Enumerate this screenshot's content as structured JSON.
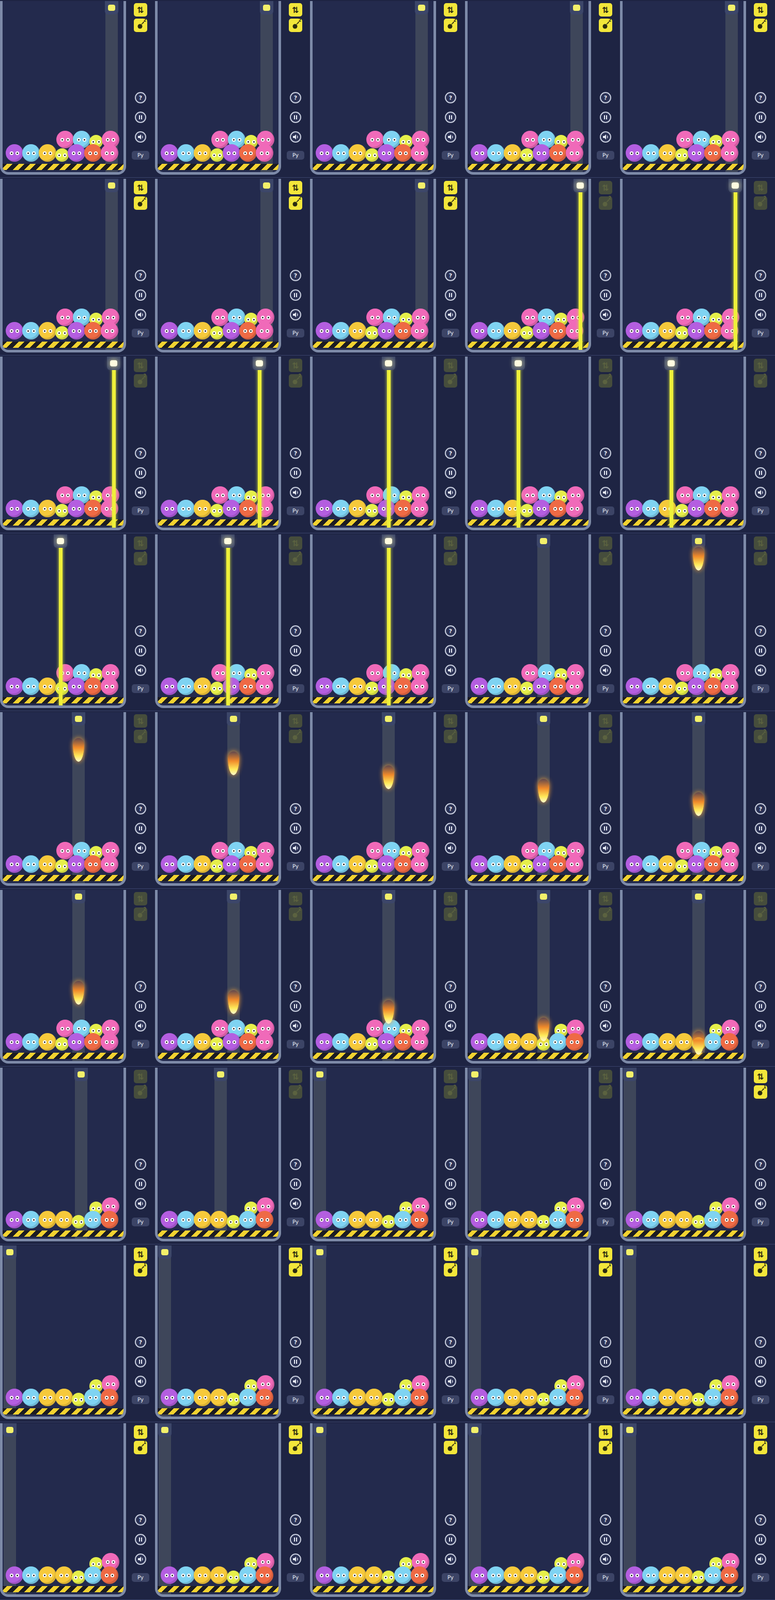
{
  "game": {
    "help": "?",
    "lang": "Py",
    "swap": "⇅"
  },
  "ballSets": [
    {
      "name": "full",
      "bottom": [
        "#b45ee0",
        "#7fd3f2",
        "#f6c93b",
        "#e6ef4a",
        "#b45ee0",
        "#ee6a45",
        "#f06ab9"
      ],
      "top": [
        "#f06ab9",
        "#7fd3f2",
        "#e6ef4a",
        "#f06ab9"
      ]
    },
    {
      "name": "burnt",
      "bottom": [
        "#b45ee0",
        "#7fd3f2",
        "#f6c93b",
        "#f6c93b",
        "#e6ef4a",
        "#7fd3f2",
        "#ee6a45"
      ],
      "top": [
        "#e6ef4a",
        "#f06ab9"
      ]
    }
  ],
  "frames": [
    {
      "aim": 0.9,
      "beam": "dim",
      "drop": 0,
      "balls": "full",
      "badges": {
        "active": true,
        "count": "2"
      }
    },
    {
      "aim": 0.9,
      "beam": "dim",
      "drop": 0,
      "balls": "full",
      "badges": {
        "active": true,
        "count": "2"
      }
    },
    {
      "aim": 0.9,
      "beam": "dim",
      "drop": 0,
      "balls": "full",
      "badges": {
        "active": true,
        "count": "2"
      }
    },
    {
      "aim": 0.9,
      "beam": "dim",
      "drop": 0,
      "balls": "full",
      "badges": {
        "active": true,
        "count": "2"
      }
    },
    {
      "aim": 0.9,
      "beam": "dim",
      "drop": 0,
      "balls": "full",
      "badges": {
        "active": true,
        "count": "2"
      }
    },
    {
      "aim": 0.9,
      "beam": "dim",
      "drop": 0,
      "balls": "full",
      "badges": {
        "active": true,
        "count": "2"
      }
    },
    {
      "aim": 0.9,
      "beam": "dim",
      "drop": 0,
      "balls": "full",
      "badges": {
        "active": true,
        "count": "2"
      }
    },
    {
      "aim": 0.9,
      "beam": "dim",
      "drop": 0,
      "balls": "full",
      "badges": {
        "active": true,
        "count": "2"
      }
    },
    {
      "aim": 0.93,
      "beam": "laser",
      "drop": 0,
      "balls": "full",
      "badges": {
        "active": false,
        "count": "2"
      }
    },
    {
      "aim": 0.93,
      "beam": "laser",
      "drop": 0,
      "balls": "full",
      "badges": {
        "active": false,
        "count": "2"
      }
    },
    {
      "aim": 0.92,
      "beam": "laser",
      "drop": 0,
      "balls": "full",
      "badges": {
        "active": false,
        "count": "2"
      }
    },
    {
      "aim": 0.84,
      "beam": "laser",
      "drop": 0,
      "balls": "full",
      "badges": {
        "active": false,
        "count": "2"
      }
    },
    {
      "aim": 0.63,
      "beam": "laser",
      "drop": 0,
      "balls": "full",
      "badges": {
        "active": false,
        "count": "2"
      }
    },
    {
      "aim": 0.42,
      "beam": "laser",
      "drop": 0,
      "balls": "full",
      "badges": {
        "active": false,
        "count": "2"
      }
    },
    {
      "aim": 0.4,
      "beam": "laser",
      "drop": 0,
      "balls": "full",
      "badges": {
        "active": false,
        "count": "2"
      }
    },
    {
      "aim": 0.48,
      "beam": "laser",
      "drop": 0,
      "balls": "full",
      "badges": {
        "active": false,
        "count": "2"
      }
    },
    {
      "aim": 0.58,
      "beam": "laser",
      "drop": 0,
      "balls": "full",
      "badges": {
        "active": false,
        "count": "2"
      }
    },
    {
      "aim": 0.63,
      "beam": "laser",
      "drop": 0,
      "balls": "full",
      "badges": {
        "active": false,
        "count": "2"
      }
    },
    {
      "aim": 0.63,
      "beam": "dim",
      "drop": 0,
      "balls": "full",
      "badges": {
        "active": false,
        "count": "2"
      }
    },
    {
      "aim": 0.63,
      "beam": "fire",
      "drop": 0.0,
      "balls": "full",
      "badges": {
        "active": false,
        "count": "2"
      }
    },
    {
      "aim": 0.63,
      "beam": "fire",
      "drop": 0.1,
      "balls": "full",
      "badges": {
        "active": false,
        "count": "2"
      }
    },
    {
      "aim": 0.63,
      "beam": "fire",
      "drop": 0.2,
      "balls": "full",
      "badges": {
        "active": false,
        "count": "2"
      }
    },
    {
      "aim": 0.63,
      "beam": "fire",
      "drop": 0.3,
      "balls": "full",
      "badges": {
        "active": false,
        "count": "2"
      }
    },
    {
      "aim": 0.63,
      "beam": "fire",
      "drop": 0.4,
      "balls": "full",
      "badges": {
        "active": false,
        "count": "2"
      }
    },
    {
      "aim": 0.63,
      "beam": "fire",
      "drop": 0.5,
      "balls": "full",
      "badges": {
        "active": false,
        "count": "2"
      }
    },
    {
      "aim": 0.63,
      "beam": "fire",
      "drop": 0.58,
      "balls": "full",
      "badges": {
        "active": false,
        "count": "2"
      }
    },
    {
      "aim": 0.63,
      "beam": "fire",
      "drop": 0.65,
      "balls": "full",
      "badges": {
        "active": false,
        "count": "2"
      }
    },
    {
      "aim": 0.63,
      "beam": "fire",
      "drop": 0.72,
      "balls": "full",
      "badges": {
        "active": false,
        "count": "2"
      }
    },
    {
      "aim": 0.63,
      "beam": "fire",
      "drop": 0.85,
      "balls": "burnt",
      "badges": {
        "active": false,
        "count": "2"
      }
    },
    {
      "aim": 0.63,
      "beam": "fire",
      "drop": 0.95,
      "balls": "burnt",
      "badges": {
        "active": false,
        "count": "2"
      }
    },
    {
      "aim": 0.65,
      "beam": "dim",
      "drop": 0,
      "balls": "burnt",
      "badges": {
        "active": false,
        "count": "2"
      }
    },
    {
      "aim": 0.52,
      "beam": "dim",
      "drop": 0,
      "balls": "burnt",
      "badges": {
        "active": false,
        "count": "2"
      }
    },
    {
      "aim": 0.06,
      "beam": "dim",
      "drop": 0,
      "balls": "burnt",
      "badges": {
        "active": false,
        "count": "2"
      }
    },
    {
      "aim": 0.06,
      "beam": "dim",
      "drop": 0,
      "balls": "burnt",
      "badges": {
        "active": false,
        "count": "2"
      }
    },
    {
      "aim": 0.06,
      "beam": "dim",
      "drop": 0,
      "balls": "burnt",
      "badges": {
        "active": true,
        "count": "1"
      }
    },
    {
      "aim": 0.06,
      "beam": "dim",
      "drop": 0,
      "balls": "burnt",
      "badges": {
        "active": true,
        "count": "1"
      }
    },
    {
      "aim": 0.06,
      "beam": "dim",
      "drop": 0,
      "balls": "burnt",
      "badges": {
        "active": true,
        "count": "1"
      }
    },
    {
      "aim": 0.06,
      "beam": "dim",
      "drop": 0,
      "balls": "burnt",
      "badges": {
        "active": true,
        "count": "1"
      }
    },
    {
      "aim": 0.06,
      "beam": "dim",
      "drop": 0,
      "balls": "burnt",
      "badges": {
        "active": true,
        "count": "1"
      }
    },
    {
      "aim": 0.06,
      "beam": "dim",
      "drop": 0,
      "balls": "burnt",
      "badges": {
        "active": true,
        "count": "1"
      }
    },
    {
      "aim": 0.06,
      "beam": "dim",
      "drop": 0,
      "balls": "burnt",
      "badges": {
        "active": true,
        "count": "1"
      }
    },
    {
      "aim": 0.06,
      "beam": "dim",
      "drop": 0,
      "balls": "burnt",
      "badges": {
        "active": true,
        "count": "1"
      }
    },
    {
      "aim": 0.06,
      "beam": "dim",
      "drop": 0,
      "balls": "burnt",
      "badges": {
        "active": true,
        "count": "1"
      }
    },
    {
      "aim": 0.06,
      "beam": "dim",
      "drop": 0,
      "balls": "burnt",
      "badges": {
        "active": true,
        "count": "1"
      }
    },
    {
      "aim": 0.06,
      "beam": "dim",
      "drop": 0,
      "balls": "burnt",
      "badges": {
        "active": true,
        "count": "1"
      }
    }
  ]
}
